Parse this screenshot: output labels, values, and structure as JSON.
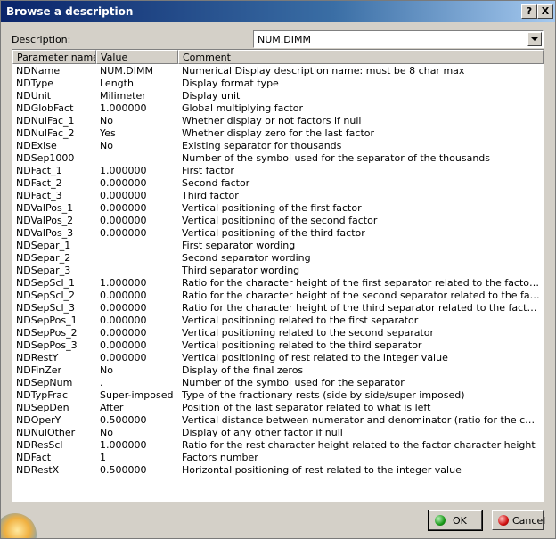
{
  "window": {
    "title": "Browse a description",
    "help_label": "?",
    "close_label": "X"
  },
  "description": {
    "label": "Description:",
    "value": "NUM.DIMM"
  },
  "table": {
    "headers": [
      "Parameter name",
      "Value",
      "Comment"
    ],
    "rows": [
      {
        "name": "NDName",
        "value": "NUM.DIMM",
        "comment": "Numerical Display description name: must be 8 char max"
      },
      {
        "name": "NDType",
        "value": "Length",
        "comment": "Display format type"
      },
      {
        "name": "NDUnit",
        "value": "Milimeter",
        "comment": "Display unit"
      },
      {
        "name": "NDGlobFact",
        "value": "1.000000",
        "comment": "Global multiplying factor"
      },
      {
        "name": "NDNulFac_1",
        "value": "No",
        "comment": "Whether display or not factors if null"
      },
      {
        "name": "NDNulFac_2",
        "value": "Yes",
        "comment": "Whether display zero for the last factor"
      },
      {
        "name": "NDExise",
        "value": "No",
        "comment": "Existing separator for thousands"
      },
      {
        "name": "NDSep1000",
        "value": "",
        "comment": "Number of the symbol used for the separator of the thousands"
      },
      {
        "name": "NDFact_1",
        "value": "1.000000",
        "comment": "First factor"
      },
      {
        "name": "NDFact_2",
        "value": "0.000000",
        "comment": "Second factor"
      },
      {
        "name": "NDFact_3",
        "value": "0.000000",
        "comment": "Third factor"
      },
      {
        "name": "NDValPos_1",
        "value": "0.000000",
        "comment": "Vertical positioning of the first factor"
      },
      {
        "name": "NDValPos_2",
        "value": "0.000000",
        "comment": "Vertical positioning of the second factor"
      },
      {
        "name": "NDValPos_3",
        "value": "0.000000",
        "comment": "Vertical positioning of the third factor"
      },
      {
        "name": "NDSepar_1",
        "value": "",
        "comment": "First separator wording"
      },
      {
        "name": "NDSepar_2",
        "value": "",
        "comment": "Second separator wording"
      },
      {
        "name": "NDSepar_3",
        "value": "",
        "comment": "Third separator wording"
      },
      {
        "name": "NDSepScl_1",
        "value": "1.000000",
        "comment": "Ratio for the character height of the first separator related to the factor charact..."
      },
      {
        "name": "NDSepScl_2",
        "value": "0.000000",
        "comment": "Ratio for the character height of the second separator related to the factor char..."
      },
      {
        "name": "NDSepScl_3",
        "value": "0.000000",
        "comment": "Ratio for the character height of the third separator related to the factor chara..."
      },
      {
        "name": "NDSepPos_1",
        "value": "0.000000",
        "comment": "Vertical positioning related to the first separator"
      },
      {
        "name": "NDSepPos_2",
        "value": "0.000000",
        "comment": "Vertical positioning related to the second separator"
      },
      {
        "name": "NDSepPos_3",
        "value": "0.000000",
        "comment": "Vertical positioning related to the third separator"
      },
      {
        "name": "NDRestY",
        "value": "0.000000",
        "comment": "Vertical positioning of rest related to the integer value"
      },
      {
        "name": "NDFinZer",
        "value": "No",
        "comment": "Display of the final zeros"
      },
      {
        "name": "NDSepNum",
        "value": ".",
        "comment": "Number of the symbol used for the separator"
      },
      {
        "name": "NDTypFrac",
        "value": "Super-imposed",
        "comment": "Type of the fractionary rests (side by side/super imposed)"
      },
      {
        "name": "NDSepDen",
        "value": "After",
        "comment": "Position of the last separator related to what is left"
      },
      {
        "name": "NDOperY",
        "value": "0.500000",
        "comment": "Vertical distance between numerator and denominator (ratio for the character h..."
      },
      {
        "name": "NDNulOther",
        "value": "No",
        "comment": "Display of any other factor if null"
      },
      {
        "name": "NDResScl",
        "value": "1.000000",
        "comment": "Ratio for the rest character height related to the factor character height"
      },
      {
        "name": "NDFact",
        "value": "1",
        "comment": "Factors number"
      },
      {
        "name": "NDRestX",
        "value": "0.500000",
        "comment": "Horizontal positioning of rest related to the integer value"
      }
    ]
  },
  "buttons": {
    "ok_label": "OK",
    "cancel_label": "Cancel"
  },
  "icons": {
    "ok": "green-dot-icon",
    "cancel": "red-dot-icon",
    "logo": "catia-logo-icon"
  }
}
